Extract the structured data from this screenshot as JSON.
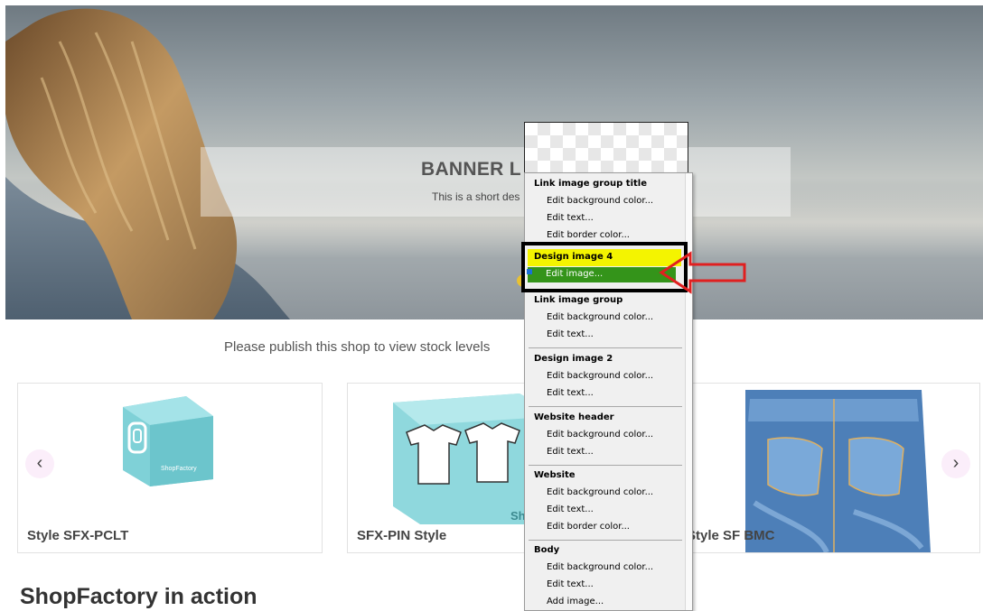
{
  "banner": {
    "title": "BANNER L",
    "description": "This is a short des"
  },
  "publish_note": "Please publish this shop to view stock levels",
  "products": [
    {
      "name": "Style SFX-PCLT",
      "icon": "shopfactory-box-icon",
      "box_label": "ShopFactory"
    },
    {
      "name": "SFX-PIN Style",
      "icon": "tshirt-box-icon",
      "box_label": "ShopFact"
    },
    {
      "name": "Style SF BMC",
      "icon": "jeans-icon"
    }
  ],
  "carousel": {
    "prev": "‹",
    "next": "›"
  },
  "section_title": "ShopFactory in action",
  "context_menu": {
    "groups": [
      {
        "title": "Link image group title",
        "items": [
          "Edit background color...",
          "Edit text...",
          "Edit border color..."
        ]
      },
      {
        "title": "Design image 4",
        "items": [
          "Edit image..."
        ],
        "highlighted": true
      },
      {
        "title": "Link image group",
        "items": [
          "Edit background color...",
          "Edit text..."
        ]
      },
      {
        "title": "Design image 2",
        "items": [
          "Edit background color...",
          "Edit text..."
        ]
      },
      {
        "title": "Website header",
        "items": [
          "Edit background color...",
          "Edit text..."
        ]
      },
      {
        "title": "Website",
        "items": [
          "Edit background color...",
          "Edit text...",
          "Edit border color..."
        ]
      },
      {
        "title": "Body",
        "items": [
          "Edit background color...",
          "Edit text...",
          "Add image..."
        ]
      }
    ]
  },
  "colors": {
    "highlight_head": "#f4f400",
    "highlight_item": "#34941a",
    "annotation_arrow": "#e02020",
    "annotation_frame": "#000000"
  }
}
